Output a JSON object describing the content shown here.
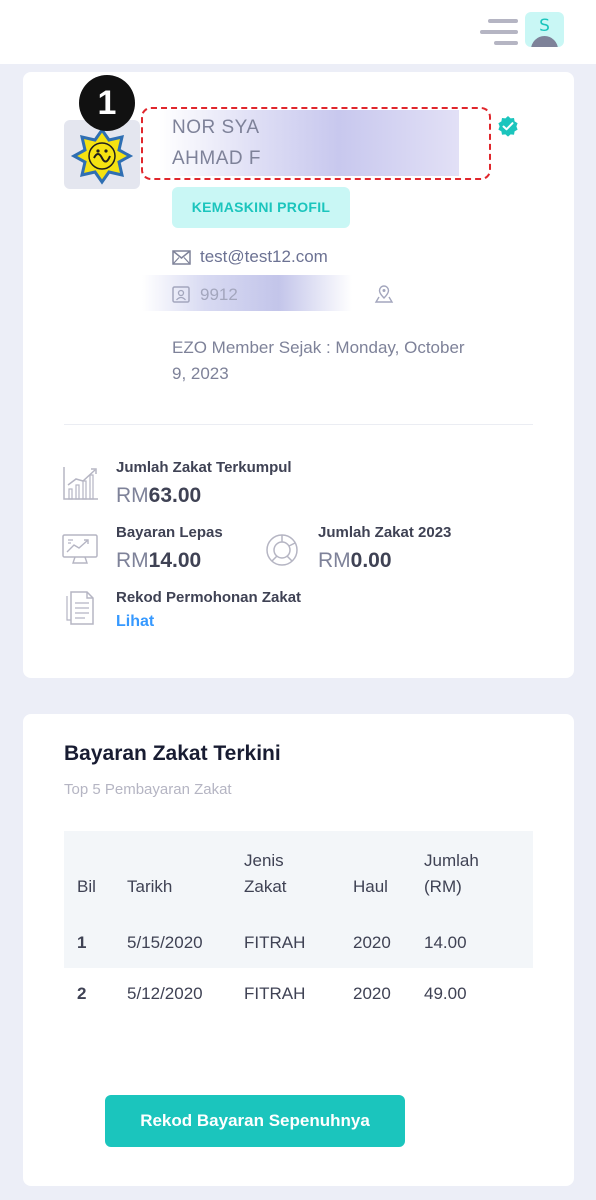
{
  "header": {
    "menu_icon": "hamburger-menu-icon",
    "avatar_initial": "S"
  },
  "profile": {
    "step_number": "1",
    "logo_icon": "zakat-logo-icon",
    "name_line1": "NOR SYA",
    "name_line2": "AHMAD F",
    "verified_icon": "verified-check-icon",
    "edit_button": "KEMASKINI PROFIL",
    "email": "test@test12.com",
    "ic_number": "9912",
    "member_since": "EZO Member Sejak : Monday, October 9, 2023"
  },
  "stats": {
    "total_label": "Jumlah Zakat Terkumpul",
    "total_currency": "RM",
    "total_value": "63.00",
    "last_payment_label": "Bayaran Lepas",
    "last_payment_currency": "RM",
    "last_payment_value": "14.00",
    "year_total_label": "Jumlah Zakat 2023",
    "year_total_currency": "RM",
    "year_total_value": "0.00",
    "records_label": "Rekod Permohonan Zakat",
    "records_link": "Lihat"
  },
  "payments": {
    "title": "Bayaran Zakat Terkini",
    "subtitle": "Top 5 Pembayaran Zakat",
    "columns": {
      "bil": "Bil",
      "tarikh": "Tarikh",
      "jenis_line1": "Jenis",
      "jenis_line2": "Zakat",
      "haul": "Haul",
      "jumlah_line1": "Jumlah",
      "jumlah_line2": "(RM)"
    },
    "rows": [
      {
        "bil": "1",
        "tarikh": "5/15/2020",
        "jenis": "FITRAH",
        "haul": "2020",
        "jumlah": "14.00"
      },
      {
        "bil": "2",
        "tarikh": "5/12/2020",
        "jenis": "FITRAH",
        "haul": "2020",
        "jumlah": "49.00"
      }
    ],
    "full_records_button": "Rekod Bayaran Sepenuhnya"
  },
  "colors": {
    "accent": "#1bc5bd",
    "accent_light": "#c9f7f5",
    "link": "#3699ff",
    "highlight": "#e0262c"
  }
}
